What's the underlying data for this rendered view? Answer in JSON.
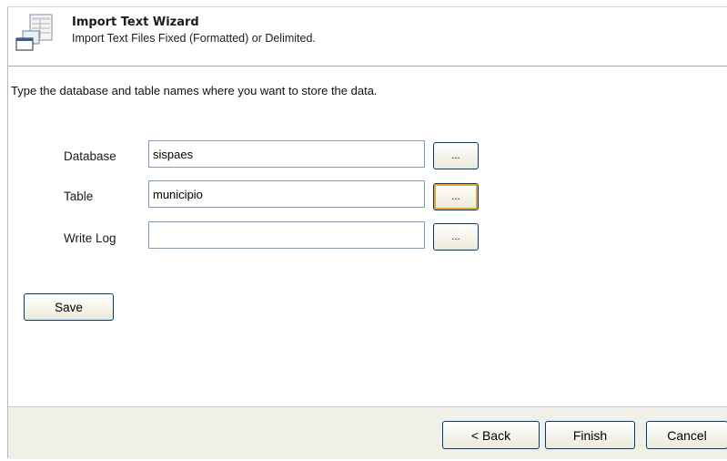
{
  "header": {
    "title": "Import Text Wizard",
    "subtitle": "Import Text Files Fixed (Formatted) or Delimited."
  },
  "instruction": "Type the database and table names where you want to store the data.",
  "form": {
    "database": {
      "label": "Database",
      "value": "sispaes",
      "browse_label": "..."
    },
    "table": {
      "label": "Table",
      "value": "municipio",
      "browse_label": "..."
    },
    "write_log": {
      "label": "Write Log",
      "value": "",
      "browse_label": "..."
    }
  },
  "save_label": "Save",
  "footer": {
    "back_label": "< Back",
    "finish_label": "Finish",
    "cancel_label": "Cancel"
  },
  "icons": {
    "wizard": "import-table-wizard-icon"
  },
  "colors": {
    "field_border": "#7f9db9",
    "button_border": "#003c74",
    "focus_highlight": "#e6a635",
    "footer_bg": "#f0efe8"
  }
}
